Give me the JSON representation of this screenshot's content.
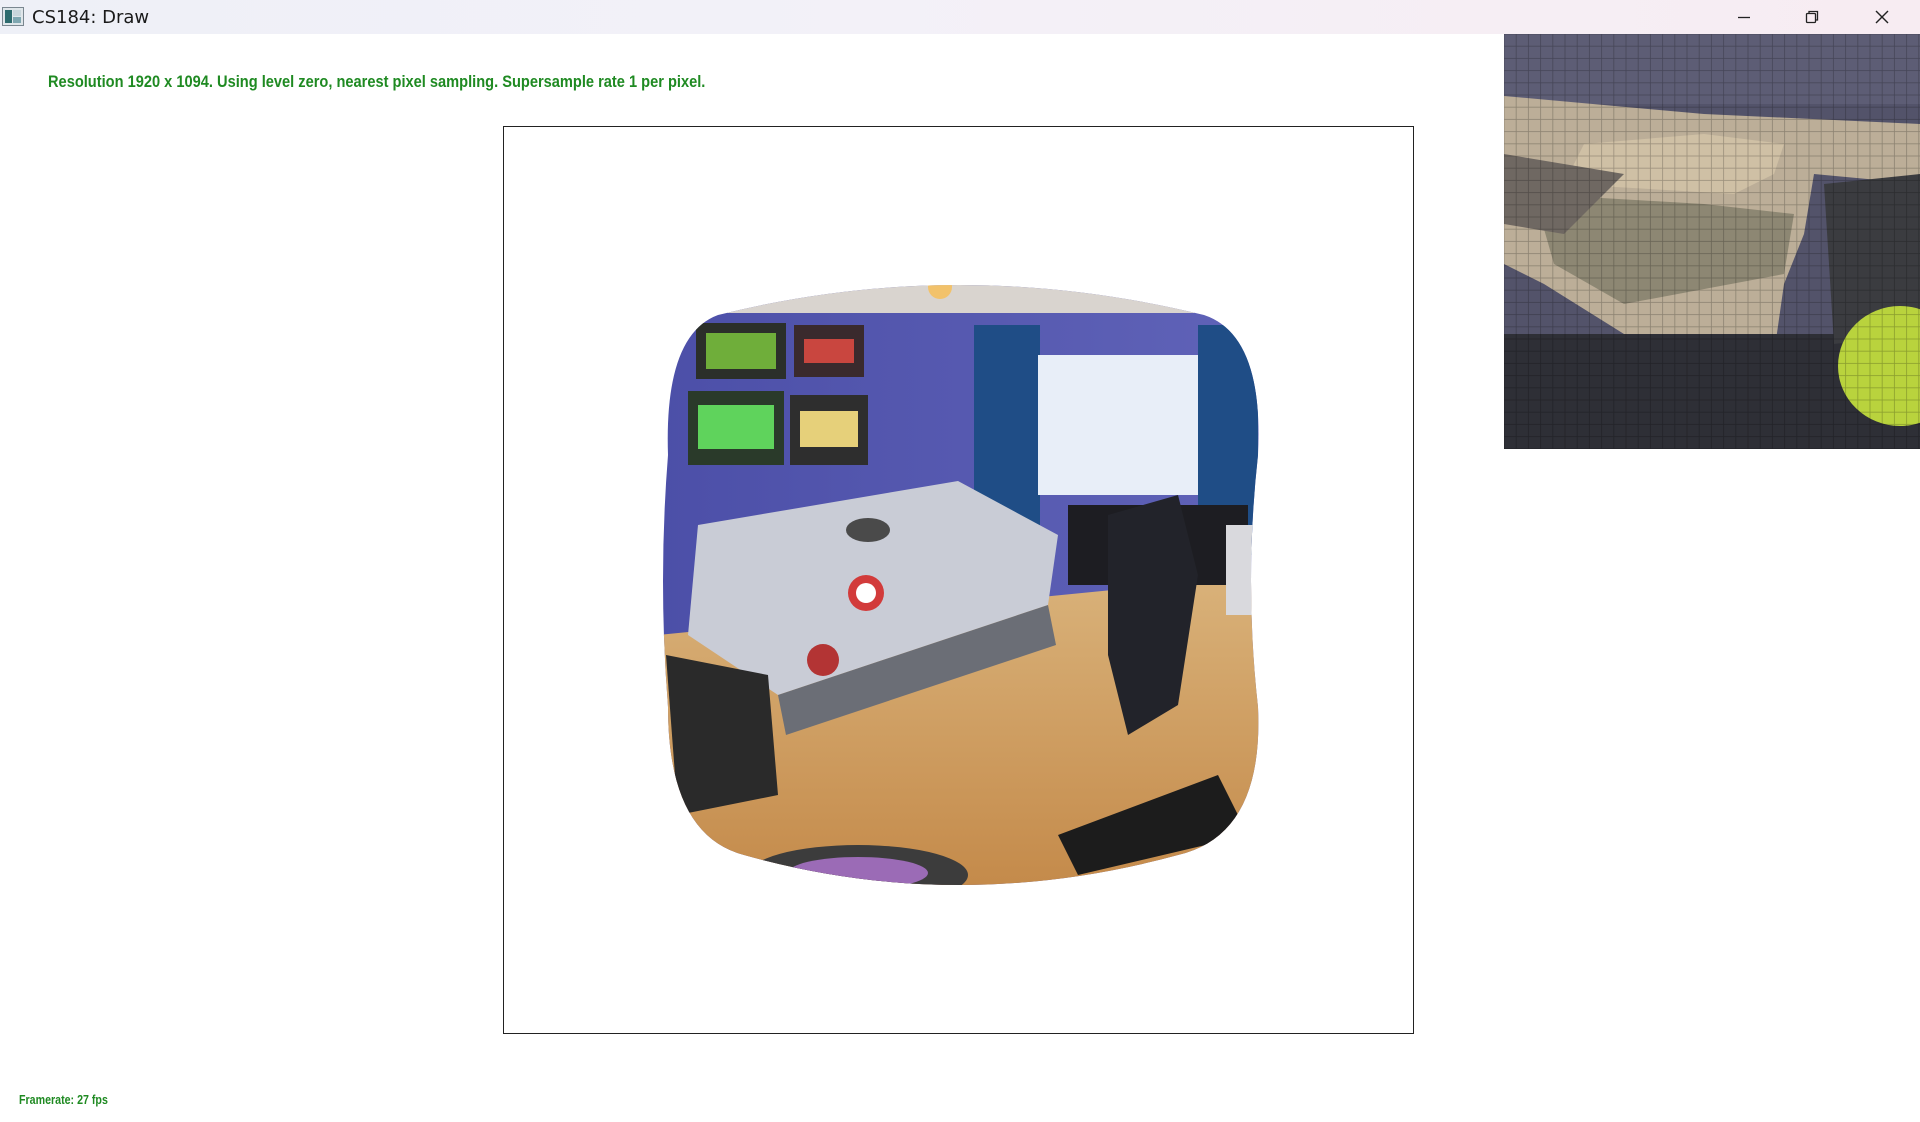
{
  "window": {
    "title": "CS184: Draw",
    "controls": {
      "minimize": "minimize-icon",
      "maximize": "restore-icon",
      "close": "close-icon"
    }
  },
  "status": {
    "info": "Resolution 1920 x 1094. Using level zero, nearest pixel sampling. Supersample rate 1 per pixel.",
    "framerate": "Framerate: 27 fps"
  },
  "colors": {
    "status_text": "#1f8a22",
    "frame_border": "#222222",
    "background": "#ffffff"
  },
  "canvas": {
    "rendered_image": "warped-bedroom-photo",
    "zoom_panel": "pixel-zoom-inspector"
  }
}
